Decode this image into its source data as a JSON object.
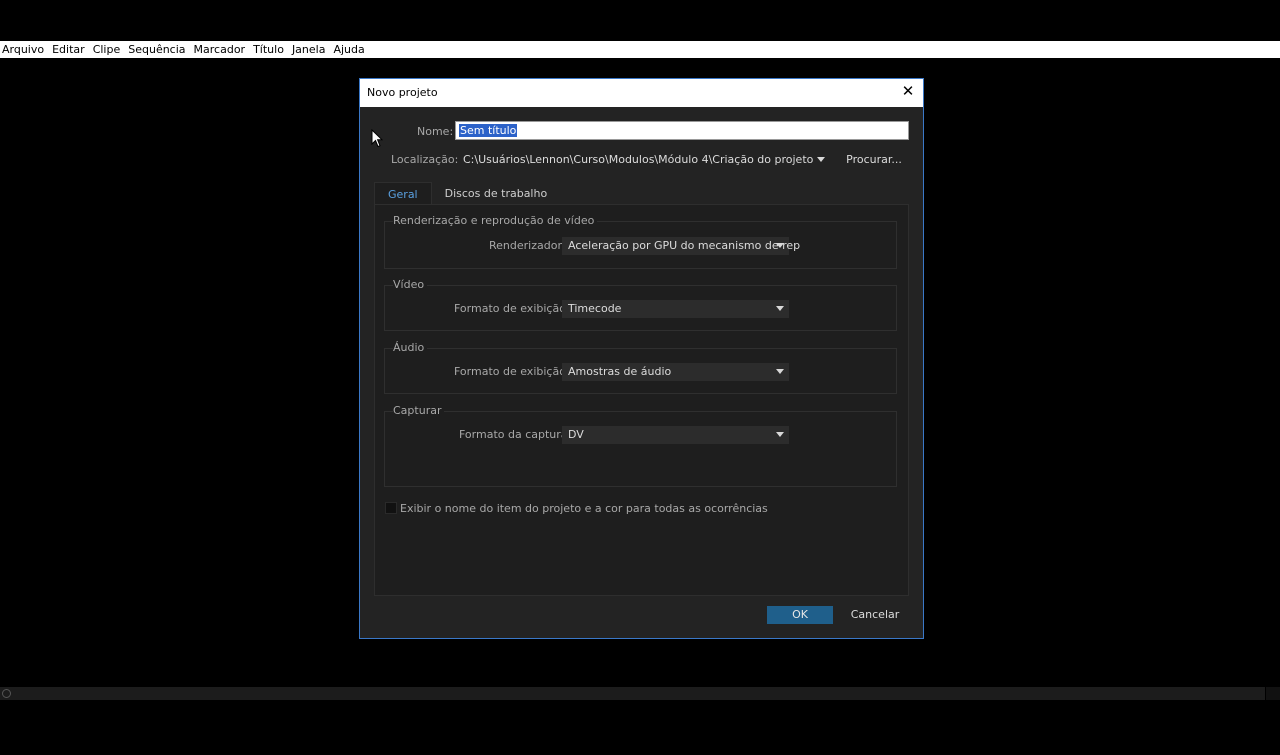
{
  "menu": [
    "Arquivo",
    "Editar",
    "Clipe",
    "Sequência",
    "Marcador",
    "Título",
    "Janela",
    "Ajuda"
  ],
  "dialog": {
    "title": "Novo projeto",
    "close_glyph": "✕",
    "name_label": "Nome:",
    "name_value": "Sem título",
    "location_label": "Localização:",
    "location_value": "C:\\Usuários\\Lennon\\Curso\\Modulos\\Módulo 4\\Criação do projeto",
    "browse_label": "Procurar...",
    "tabs": [
      "Geral",
      "Discos de trabalho"
    ],
    "render_group": {
      "title": "Renderização e reprodução de vídeo",
      "renderer_label": "Renderizador:",
      "renderer_value": "Aceleração por GPU do mecanismo de rep"
    },
    "video_group": {
      "title": "Vídeo",
      "format_label": "Formato de exibição:",
      "format_value": "Timecode"
    },
    "audio_group": {
      "title": "Áudio",
      "format_label": "Formato de exibição:",
      "format_value": "Amostras de áudio"
    },
    "capture_group": {
      "title": "Capturar",
      "format_label": "Formato da captura:",
      "format_value": "DV"
    },
    "checkbox_label": "Exibir o nome do item do projeto e a cor para todas as ocorrências",
    "ok_label": "OK",
    "cancel_label": "Cancelar"
  },
  "colors": {
    "accent": "#1f5f8b",
    "active_tab": "#5aa0e0",
    "dialog_border": "#3a78c8",
    "selection": "#2c62c9"
  }
}
